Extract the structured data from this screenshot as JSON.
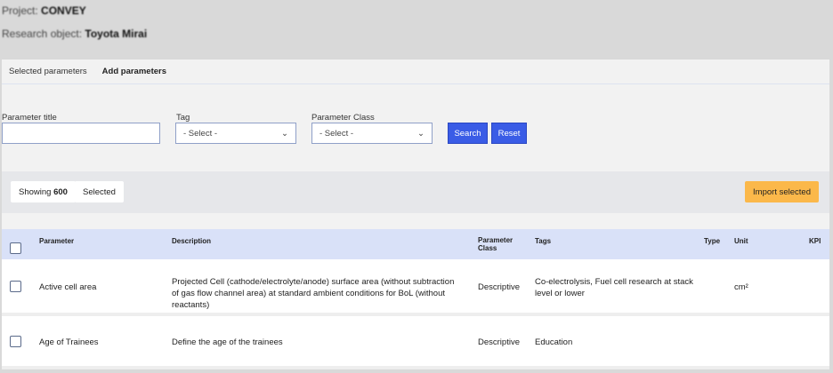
{
  "header": {
    "project_label": "Project:",
    "project": "CONVEY",
    "object_label": "Research object:",
    "object": "Toyota Mirai"
  },
  "tabs": [
    {
      "label": "Selected parameters"
    },
    {
      "label": "Add parameters"
    }
  ],
  "filters": {
    "title_label": "Parameter title",
    "title_value": "",
    "tag_label": "Tag",
    "tag_value": "- Select -",
    "class_label": "Parameter Class",
    "class_value": "- Select -",
    "search": "Search",
    "reset": "Reset"
  },
  "toolbar": {
    "showing_label": "Showing",
    "showing_count": "600",
    "selected": "Selected",
    "import": "Import selected"
  },
  "table": {
    "columns": [
      "Parameter",
      "Description",
      "Parameter Class",
      "Tags",
      "Type",
      "Unit",
      "KPI"
    ],
    "rows": [
      {
        "parameter": "Active cell area",
        "description": "Projected Cell (cathode/electrolyte/anode) surface area (without subtraction of gas flow channel area) at standard ambient conditions for BoL (without reactants)",
        "class": "Descriptive",
        "tags": "Co-electrolysis, Fuel cell research at stack level or lower",
        "type": "",
        "unit": "cm²",
        "kpi": ""
      },
      {
        "parameter": "Age of Trainees",
        "description": "Define the age of the trainees",
        "class": "Descriptive",
        "tags": "Education",
        "type": "",
        "unit": "",
        "kpi": ""
      }
    ]
  }
}
